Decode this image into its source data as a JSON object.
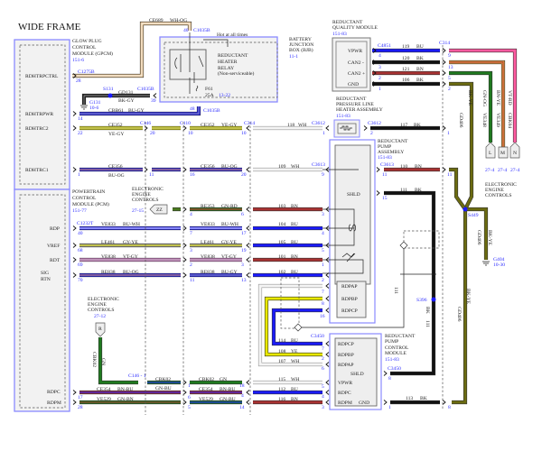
{
  "title": "WIDE FRAME",
  "colors": {
    "BU": "#1a1aff",
    "BK": "#111111",
    "BN": "#a83232",
    "WH": "#f4f4f4",
    "YE": "#e8e800",
    "GN": "#1f7a1f",
    "GY": "#9a9a9a",
    "OG": "#e8a040",
    "VT": "#e48ad8",
    "RD": "#d03030",
    "PK": "#ff5aa0",
    "DKGN": "#4a7a20",
    "BKYE": "#6b6b10",
    "TAN": "#f0c890"
  },
  "gpcm": {
    "name1": "GLOW PLUG",
    "name2": "CONTROL",
    "name3": "MODULE (GPCM)",
    "ref": "151-6",
    "pins": {
      "rdhtrpctrl": "RDHTRPCTRL",
      "rdhtrpwr": "RDHTRPWR",
      "rdhtrc2": "RDHTRC2",
      "rdhtrc1": "RDHTRC1"
    }
  },
  "pcm": {
    "name1": "POWERTRAIN",
    "name2": "CONTROL",
    "name3": "MODULE (PCM)",
    "ref": "151-77",
    "pins": {
      "rdp": "RDP",
      "vref": "VREF",
      "rdt": "RDT",
      "sig": "SIG",
      "rtn": "RTN",
      "rdpc": "RDPC",
      "rdpm": "RDPM"
    }
  },
  "bjb": {
    "name1": "BATTERY",
    "name2": "JUNCTION",
    "name3": "BOX (BJB)",
    "ref": "11-1",
    "hot": "Hot at all times",
    "relay1": "REDUCTANT",
    "relay2": "HEATER",
    "relay3": "RELAY",
    "relay4": "(Non-serviceable)",
    "fuse": "F61",
    "fuse_amp": "25A",
    "fuse_ref": "13-22"
  },
  "rqm": {
    "name1": "REDUCTANT",
    "name2": "QUALITY MODULE",
    "ref": "151-83",
    "pins": {
      "vpwr": "VPWR",
      "can_lo": "CAN2 -",
      "can_hi": "CAN2 +",
      "gnd": "GND"
    }
  },
  "heater": {
    "name1": "REDUCTANT",
    "name2": "PRESSURE LINE",
    "name3": "HEATER ASSEMBLY",
    "ref": "151-83"
  },
  "pump": {
    "name1": "REDUCTANT",
    "name2": "PUMP",
    "name3": "ASSEMBLY",
    "ref": "151-83",
    "shld": "SHLD",
    "pins": {
      "rdpap": "RDPAP",
      "rdpbp": "RDPBP",
      "rdpcp": "RDPCP"
    }
  },
  "rpcm": {
    "name1": "REDUCTANT",
    "name2": "PUMP",
    "name3": "CONTROL",
    "name4": "MODULE",
    "ref": "151-83",
    "pins": {
      "rdpcp": "RDPCP",
      "rdpbp": "RDPBP",
      "rdpap": "RDPAP",
      "shld": "SHLD",
      "vpwr": "VPWR",
      "rdpc": "RDPC",
      "rdpm": "RDPM",
      "gnd": "GND"
    }
  },
  "eec": {
    "line1": "ELECTRONIC",
    "line2": "ENGINE",
    "line3": "CONTROLS",
    "ref_zz": "27-15",
    "zz": "ZZ",
    "ref_r": "27-12",
    "r": "R",
    "l": "L",
    "m": "M",
    "n": "N",
    "ref_lmn": "27-4"
  },
  "connectors": {
    "c1035b": "C1035B",
    "c1275b": "C1275B",
    "c146": "C146",
    "c110": "C110",
    "c314": "C314",
    "c3612": "C3612",
    "c3613": "C3613",
    "c1232t": "C1232T",
    "c4851": "C4851",
    "c3450": "C3450",
    "c146_1": "C146 - 1"
  },
  "splices": {
    "s131": "S131",
    "s449": "S449",
    "s396": "S396"
  },
  "grounds": {
    "g131": "G131",
    "g131_ref": "10-6",
    "g404": "G404",
    "g404_ref": "10-30"
  },
  "circuits": {
    "ce689": "CE689",
    "wh_og": "WH-OG",
    "gd131": "GD131",
    "bk_gy": "BK-GY",
    "cbb61": "CBB61",
    "bu_gy": "BU-GY",
    "ce352": "CE352",
    "ye_gy": "YE-GY",
    "ce356": "CE356",
    "bu_og": "BU-OG",
    "re353": "RE353",
    "gn_rd": "GN-RD",
    "ve833": "VE833",
    "bu_wh": "BU-WH",
    "le461": "LE461",
    "gy_ye": "GY-YE",
    "ve838": "VE838",
    "vt_gy": "VT-GY",
    "re838": "RE838",
    "cbk02": "CBK02",
    "gn": "GN",
    "gn_bu": "GN-BU",
    "ce354": "CE354",
    "bn_bu": "BN-BU",
    "ve529": "VE529",
    "gn_bn": "GN-BN",
    "gd406": "GD406",
    "bk_ye": "BK-YE",
    "ve348": "VE348",
    "gn_og": "GN-OG",
    "ve349": "VE349",
    "bn_ye": "BN-YE",
    "cbk04": "CBK04",
    "vt_rd": "VT-RD",
    "n118": "118",
    "n117": "117",
    "n109": "109",
    "n110": "110",
    "n111": "111",
    "n103": "103",
    "n104": "104",
    "n105": "105",
    "n101": "101",
    "n102": "102",
    "n115": "115",
    "n112": "112",
    "n116": "116",
    "n114": "114",
    "n108": "108",
    "n107": "107",
    "n113": "113",
    "n119": "119",
    "n120": "120",
    "n121": "121",
    "n106": "106",
    "wh": "WH",
    "bk": "BK",
    "bn": "BN",
    "bu": "BU",
    "ye": "YE"
  },
  "pin_numbers": {
    "p40": "40",
    "p28": "28",
    "p39": "39",
    "p48": "48",
    "p14": "14",
    "p22": "22",
    "p20": "20",
    "p10": "10",
    "p1": "1",
    "p11": "11",
    "p16": "16",
    "p4": "4",
    "p6": "6",
    "p7": "7",
    "p17": "17",
    "p68": "68",
    "p3": "3",
    "p19": "19",
    "p69": "69",
    "p2": "2",
    "p70": "70",
    "p13": "13",
    "p18": "18",
    "p5": "5",
    "p9": "9",
    "p15": "15",
    "p8": "8"
  }
}
